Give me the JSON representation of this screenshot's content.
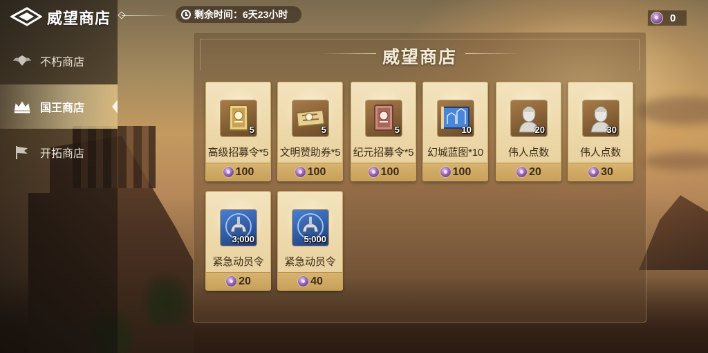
{
  "header": {
    "title": "威望商店",
    "timer_text": "剩余时间：6天23小时",
    "currency_value": "0"
  },
  "sidebar": {
    "items": [
      {
        "label": "不朽商店",
        "icon": "wings-shield-icon",
        "active": false
      },
      {
        "label": "国王商店",
        "icon": "crown-icon",
        "active": true
      },
      {
        "label": "开拓商店",
        "icon": "flag-icon",
        "active": false
      }
    ]
  },
  "panel": {
    "title": "威望商店"
  },
  "shop_items": [
    {
      "name": "高级招募令*5",
      "qty": "5",
      "price": "100",
      "icon": "gold-recruit-card-icon"
    },
    {
      "name": "文明赞助券*5",
      "qty": "5",
      "price": "100",
      "icon": "scroll-ticket-icon"
    },
    {
      "name": "纪元招募令*5",
      "qty": "5",
      "price": "100",
      "icon": "bronze-recruit-card-icon"
    },
    {
      "name": "幻城蓝图*10",
      "qty": "10",
      "price": "100",
      "icon": "blueprint-icon"
    },
    {
      "name": "伟人点数",
      "qty": "20",
      "price": "20",
      "icon": "bust-statue-icon"
    },
    {
      "name": "伟人点数",
      "qty": "30",
      "price": "30",
      "icon": "bust-statue-icon"
    },
    {
      "name": "紧急动员令",
      "qty": "3,000",
      "price": "20",
      "icon": "spartan-helmet-icon"
    },
    {
      "name": "紧急动员令",
      "qty": "5,000",
      "price": "40",
      "icon": "spartan-helmet-icon"
    }
  ],
  "colors": {
    "card_bg": "#f3e3bd",
    "price_bar": "#d7b470",
    "text_dark": "#3a2a18",
    "currency_gem": "#9a6bb4"
  }
}
